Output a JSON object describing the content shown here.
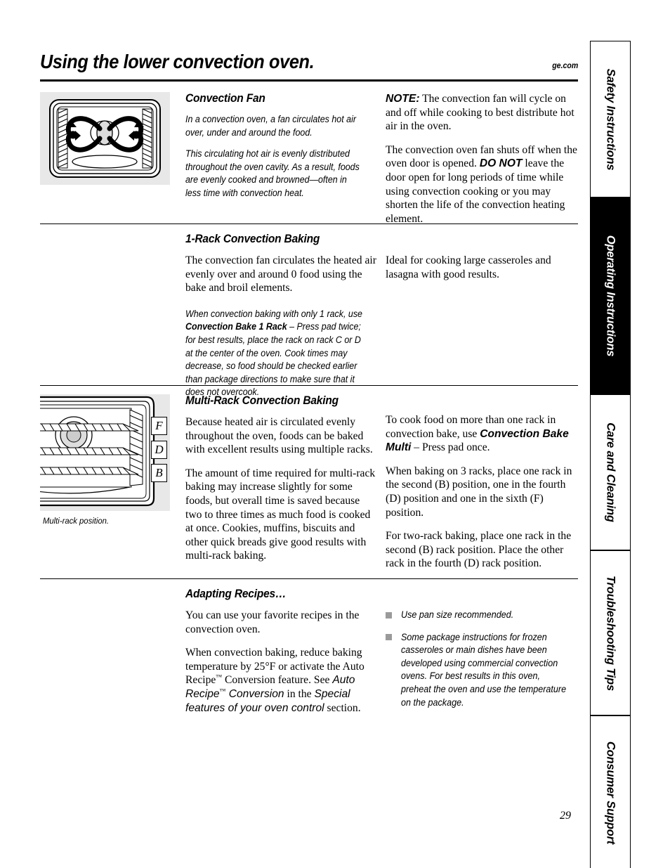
{
  "header": {
    "title": "Using the lower convection oven.",
    "website": "ge.com"
  },
  "sections": [
    {
      "id": "convection-fan",
      "heading": "Convection Fan",
      "artwork": {
        "name": "convection-oven-airflow-illustration",
        "caption": ""
      },
      "mid_paragraphs": [
        "In a convection oven, a fan circulates hot air over, under and around the food.",
        "This circulating hot air is evenly distributed throughout the oven cavity. As a result, foods are evenly cooked and browned—often in less time with convection heat."
      ],
      "right_paragraphs": [
        {
          "lead_bold": "NOTE:",
          "text": " The convection fan will cycle on and off while cooking to best distribute hot air in the oven."
        },
        {
          "text_before": "The convection oven fan shuts off when the oven door is opened. ",
          "bold": "DO NOT",
          "text_after": " leave the door open for long periods of time while using convection cooking or you may shorten the life of the convection heating element."
        }
      ]
    },
    {
      "id": "one-rack-convection-baking",
      "heading": "1-Rack Convection Baking",
      "serif_paragraph": "The convection fan circulates the heated air evenly over and around 0 food using the bake and broil elements.",
      "italic_paragraph": {
        "before": "When convection baking with only 1 rack, use ",
        "bold": "Convection Bake 1 Rack",
        "after": " – Press pad twice; for best results, place the rack on rack C or D at the center of the oven. Cook times may decrease, so food should be checked earlier than package directions to make sure that it does not overcook."
      },
      "right_paragraph": "Ideal for cooking large casseroles and lasagna with good results."
    },
    {
      "id": "multi-rack-convection-baking",
      "heading": "Multi-Rack Convection Baking",
      "artwork": {
        "name": "multi-rack-oven-illustration",
        "caption": "Multi-rack position.",
        "rack_labels": [
          "F",
          "D",
          "B"
        ]
      },
      "mid_paragraphs": [
        "Because heated air is circulated evenly throughout the oven, foods can be baked with excellent results using multiple racks.",
        "The amount of time required for multi-rack baking may increase slightly for some foods, but overall time is saved because two to three times as much food is cooked at once. Cookies, muffins, biscuits and other quick breads give good results with multi-rack baking."
      ],
      "right_paragraphs": [
        {
          "before": "To cook food on more than one rack in convection bake, use ",
          "bold": "Convection Bake Multi",
          "after": " – Press pad once."
        },
        {
          "text": "When baking on 3 racks, place one rack in the second (B) position, one in the fourth (D) position and one in the sixth (F) position."
        },
        {
          "text": "For two-rack baking, place one rack in the second (B) rack position. Place the other rack in the fourth (D) rack position."
        }
      ]
    },
    {
      "id": "adapting-recipes",
      "heading": "Adapting Recipes…",
      "mid_paragraph_1": "You can use your favorite recipes in the convection oven.",
      "mid_paragraph_2": {
        "p1": "When convection baking, reduce baking temperature by 25°F or activate the Auto Recipe",
        "tm1": "™",
        "p2": " Conversion feature. See ",
        "ital1": "Auto Recipe",
        "tm2": "™",
        "ital1b": " Conversion",
        "p3": " in the ",
        "ital2": "Special features of your oven control",
        "p4": " section."
      },
      "bullets": [
        "Use pan size recommended.",
        "Some package instructions for frozen casseroles or main dishes have been developed using commercial convection ovens. For best results in this oven, preheat the oven and use the temperature on the package."
      ]
    }
  ],
  "sidebar": {
    "tabs": [
      {
        "label": "Safety Instructions",
        "active": false
      },
      {
        "label": "Operating Instructions",
        "active": true
      },
      {
        "label": "Care and Cleaning",
        "active": false
      },
      {
        "label": "Troubleshooting Tips",
        "active": false
      },
      {
        "label": "Consumer Support",
        "active": false
      }
    ]
  },
  "footer": {
    "page_number": "29"
  },
  "colors": {
    "art_panel_bg": "#e8e8e8",
    "bullet_square": "#9a9a9a",
    "active_tab_bg": "#000000",
    "text": "#000000"
  }
}
